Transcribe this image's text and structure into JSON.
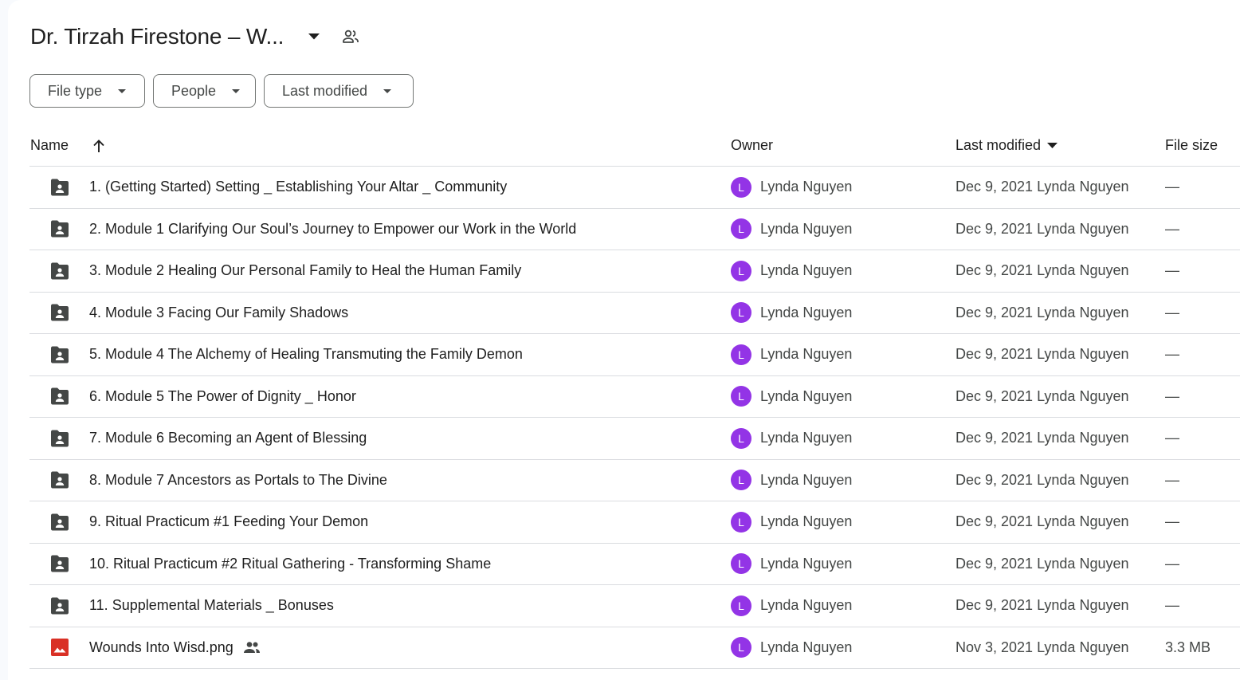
{
  "header": {
    "folder_title": "Dr. Tirzah Firestone – W..."
  },
  "filters": {
    "file_type": "File type",
    "people": "People",
    "last_modified": "Last modified"
  },
  "columns": {
    "name": "Name",
    "owner": "Owner",
    "last_modified": "Last modified",
    "file_size": "File size"
  },
  "rows": [
    {
      "type": "shared-folder",
      "name": "1. (Getting Started) Setting _ Establishing Your Altar _ Community",
      "owner_initial": "L",
      "owner": "Lynda Nguyen",
      "modified": "Dec 9, 2021 Lynda Nguyen",
      "size": "—"
    },
    {
      "type": "shared-folder",
      "name": "2. Module 1 Clarifying Our Soul’s Journey to Empower our Work in the World",
      "owner_initial": "L",
      "owner": "Lynda Nguyen",
      "modified": "Dec 9, 2021 Lynda Nguyen",
      "size": "—"
    },
    {
      "type": "shared-folder",
      "name": "3. Module 2 Healing Our Personal Family to Heal the Human Family",
      "owner_initial": "L",
      "owner": "Lynda Nguyen",
      "modified": "Dec 9, 2021 Lynda Nguyen",
      "size": "—"
    },
    {
      "type": "shared-folder",
      "name": "4. Module 3 Facing Our Family Shadows",
      "owner_initial": "L",
      "owner": "Lynda Nguyen",
      "modified": "Dec 9, 2021 Lynda Nguyen",
      "size": "—"
    },
    {
      "type": "shared-folder",
      "name": "5. Module 4 The Alchemy of Healing Transmuting the Family Demon",
      "owner_initial": "L",
      "owner": "Lynda Nguyen",
      "modified": "Dec 9, 2021 Lynda Nguyen",
      "size": "—"
    },
    {
      "type": "shared-folder",
      "name": "6. Module 5 The Power of Dignity _ Honor",
      "owner_initial": "L",
      "owner": "Lynda Nguyen",
      "modified": "Dec 9, 2021 Lynda Nguyen",
      "size": "—"
    },
    {
      "type": "shared-folder",
      "name": "7. Module 6 Becoming an Agent of Blessing",
      "owner_initial": "L",
      "owner": "Lynda Nguyen",
      "modified": "Dec 9, 2021 Lynda Nguyen",
      "size": "—"
    },
    {
      "type": "shared-folder",
      "name": "8. Module 7 Ancestors as Portals to The Divine",
      "owner_initial": "L",
      "owner": "Lynda Nguyen",
      "modified": "Dec 9, 2021 Lynda Nguyen",
      "size": "—"
    },
    {
      "type": "shared-folder",
      "name": "9. Ritual Practicum #1 Feeding Your Demon",
      "owner_initial": "L",
      "owner": "Lynda Nguyen",
      "modified": "Dec 9, 2021 Lynda Nguyen",
      "size": "—"
    },
    {
      "type": "shared-folder",
      "name": "10. Ritual Practicum #2 Ritual Gathering - Transforming Shame",
      "owner_initial": "L",
      "owner": "Lynda Nguyen",
      "modified": "Dec 9, 2021 Lynda Nguyen",
      "size": "—"
    },
    {
      "type": "shared-folder",
      "name": "11. Supplemental Materials _ Bonuses",
      "owner_initial": "L",
      "owner": "Lynda Nguyen",
      "modified": "Dec 9, 2021 Lynda Nguyen",
      "size": "—"
    },
    {
      "type": "image",
      "name": "Wounds Into Wisd.png",
      "shared": true,
      "owner_initial": "L",
      "owner": "Lynda Nguyen",
      "modified": "Nov 3, 2021 Lynda Nguyen",
      "size": "3.3 MB"
    }
  ],
  "colors": {
    "avatar": "#9334e6",
    "folder_icon": "#444746",
    "image_icon": "#d93025",
    "divider": "#dadce0"
  }
}
